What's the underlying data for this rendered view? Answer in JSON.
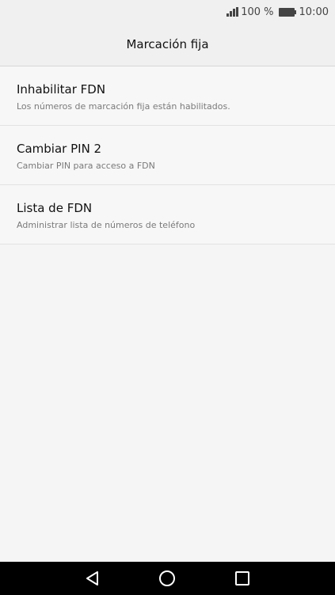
{
  "status_bar": {
    "battery_percent": "100 %",
    "time": "10:00",
    "icons": [
      "signal-icon",
      "battery-icon"
    ]
  },
  "header": {
    "title": "Marcación fija"
  },
  "settings": {
    "items": [
      {
        "title": "Inhabilitar FDN",
        "subtitle": "Los números de marcación fija están habilitados."
      },
      {
        "title": "Cambiar PIN 2",
        "subtitle": "Cambiar PIN para acceso a FDN"
      },
      {
        "title": "Lista de FDN",
        "subtitle": "Administrar lista de números de teléfono"
      }
    ]
  },
  "navigation": {
    "icons": [
      "back-icon",
      "home-icon",
      "recent-apps-icon"
    ]
  }
}
